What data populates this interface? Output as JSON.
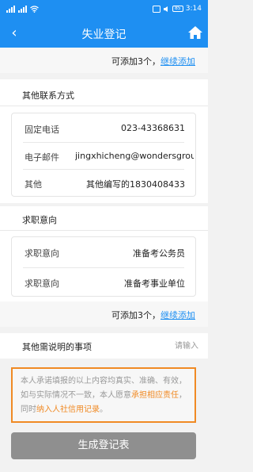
{
  "status_bar": {
    "time": "3:14",
    "battery": "85"
  },
  "nav": {
    "title": "失业登记",
    "back_icon": "chevron-left-icon",
    "home_icon": "home-icon"
  },
  "add_more_top": {
    "text": "可添加3个，",
    "link": "继续添加"
  },
  "contacts": {
    "title": "其他联系方式",
    "rows": [
      {
        "label": "固定电话",
        "value": "023-43368631"
      },
      {
        "label": "电子邮件",
        "value": "jingxhicheng@wondersgroup.c"
      },
      {
        "label": "其他",
        "value": "其他编写的1830408433"
      }
    ]
  },
  "intentions": {
    "title": "求职意向",
    "rows": [
      {
        "label": "求职意向",
        "value": "准备考公务员"
      },
      {
        "label": "求职意向",
        "value": "准备考事业单位"
      }
    ]
  },
  "add_more_bottom": {
    "text": "可添加3个，",
    "link": "继续添加"
  },
  "other_matters": {
    "label": "其他需说明的事项",
    "placeholder": "请输入"
  },
  "pledge": {
    "part1": "本人承诺填报的以上内容均真实、准确、有效，如与实际情况不一致，本人愿意",
    "highlight1": "承担相应责任",
    "part2": "，同时",
    "highlight2": "纳入人社信用记录",
    "part3": "。"
  },
  "generate_button": "生成登记表",
  "colors": {
    "primary": "#1e8ff2",
    "accent_orange": "#f08a24",
    "button_disabled": "#8f8f8f"
  }
}
